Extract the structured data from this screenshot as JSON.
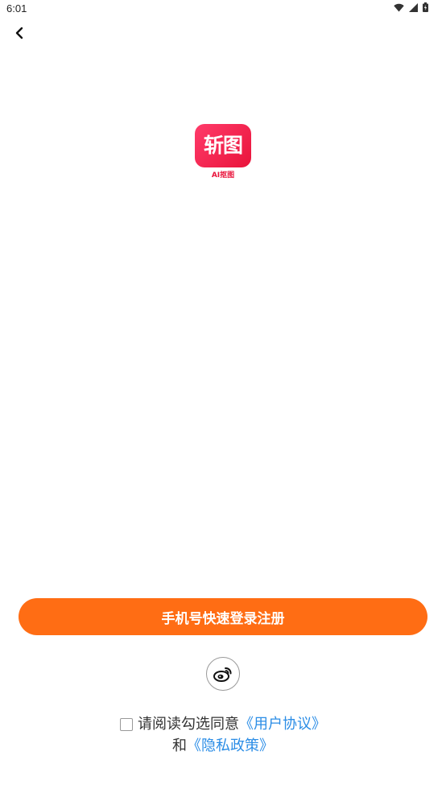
{
  "status_bar": {
    "time": "6:01"
  },
  "logo": {
    "text": "斩图",
    "subtitle": "AI抠图"
  },
  "login": {
    "phone_button_label": "手机号快速登录注册"
  },
  "agreement": {
    "prefix": "请阅读勾选同意",
    "user_agreement": "《用户协议》",
    "conjunction": "和",
    "privacy_policy": "《隐私政策》"
  },
  "colors": {
    "accent": "#ff6d14",
    "brand": "#e9143b",
    "link": "#2b8de6"
  }
}
